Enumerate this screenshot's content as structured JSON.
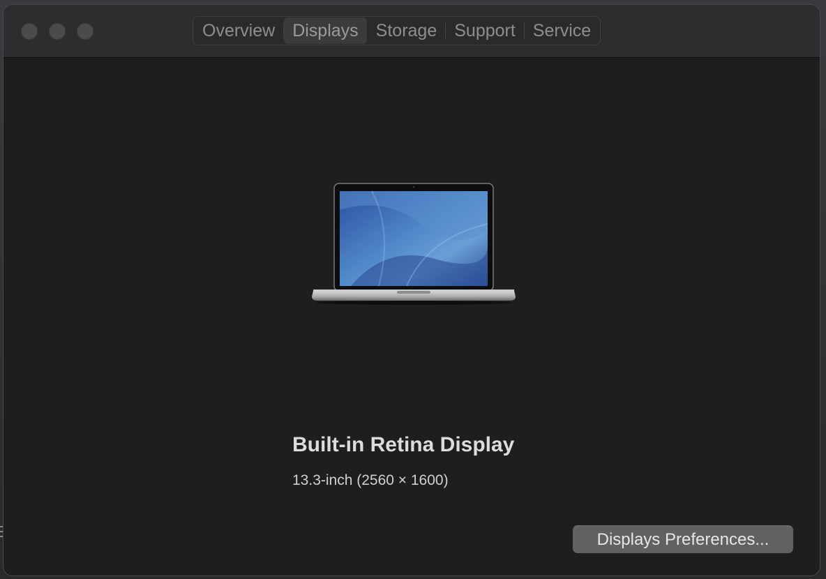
{
  "window": {
    "tabs": [
      {
        "label": "Overview",
        "selected": false
      },
      {
        "label": "Displays",
        "selected": true
      },
      {
        "label": "Storage",
        "selected": false
      },
      {
        "label": "Support",
        "selected": false
      },
      {
        "label": "Service",
        "selected": false
      }
    ]
  },
  "display": {
    "name": "Built-in Retina Display",
    "spec": "13.3-inch (2560 × 1600)",
    "image_icon": "macbook-laptop-icon"
  },
  "actions": {
    "preferences_label": "Displays Preferences..."
  },
  "colors": {
    "window_bg": "#1e1e1e",
    "titlebar_bg": "#2d2d2f",
    "button_bg": "#616163",
    "screen_blue": "#2f5fb0"
  }
}
